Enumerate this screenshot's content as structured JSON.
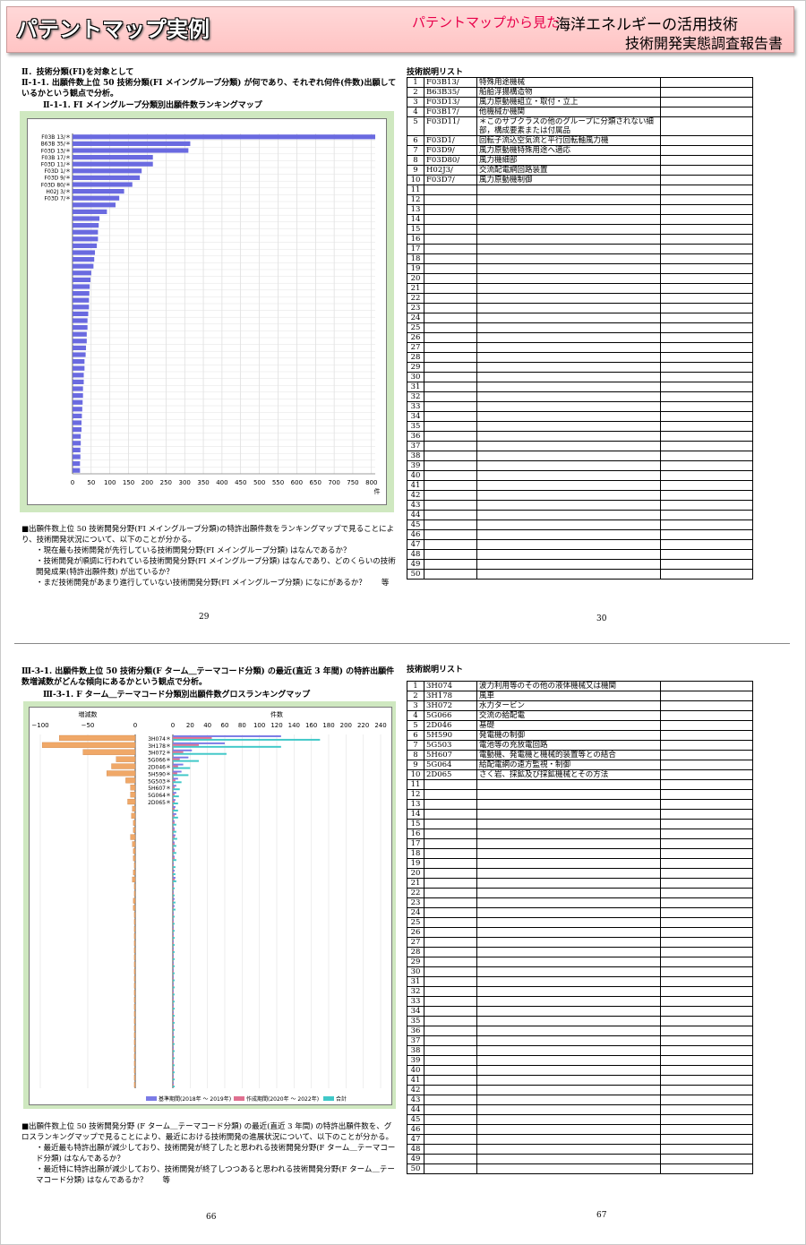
{
  "banner": {
    "title": "パテントマップ実例",
    "subtitle_red": "パテントマップから見た",
    "subtitle_main": "海洋エネルギーの活用技術",
    "subtitle_report": "技術開発実態調査報告書"
  },
  "page29": {
    "section": "Ⅱ．技術分類(FI)を対象として",
    "heading": "Ⅱ-1-1. 出願件数上位 50 技術分類(FI メイングループ分類) が何であり、それぞれ何件(件数)出願しているかという観点で分析。",
    "chart_title": "Ⅱ-1-1. FI メイングループ分類別出願件数ランキングマップ",
    "notes": [
      "■出願件数上位 50 技術開発分野(FI メイングループ分類)の特許出願件数をランキングマップで見ることにより、技術開発状況について、以下のことが分かる。",
      "・現在最も技術開発が先行している技術開発分野(FI メイングループ分類) はなんであるか？",
      "・技術開発が順調に行われている技術開発分野(FI メイングループ分類) はなんであり、どのくらいの技術開発成果(特許出願件数) が出ているか？",
      "・まだ技術開発があまり進行していない技術開発分野(FI メイングループ分類) になにがあるか？　　等"
    ],
    "page_number": "29"
  },
  "page30": {
    "list_title": "技術説明リスト",
    "rows": [
      {
        "no": "1",
        "code": "F03B13/",
        "desc": "特殊用途機械"
      },
      {
        "no": "2",
        "code": "B63B35/",
        "desc": "船舶浮揚構造物"
      },
      {
        "no": "3",
        "code": "F03D13/",
        "desc": "風力原動機組立・取付・立上"
      },
      {
        "no": "4",
        "code": "F03B17/",
        "desc": "他機械か機関"
      },
      {
        "no": "5",
        "code": "F03D11/",
        "desc": "＊このサブクラスの他のグループに分類されない細部，構成要素または付属品"
      },
      {
        "no": "6",
        "code": "F03D1/",
        "desc": "回転子流込空気流と平行回転軸風力機"
      },
      {
        "no": "7",
        "code": "F03D9/",
        "desc": "風力原動機特殊用途へ適応"
      },
      {
        "no": "8",
        "code": "F03D80/",
        "desc": "風力機細部"
      },
      {
        "no": "9",
        "code": "H02J3/",
        "desc": "交流配電網回路装置"
      },
      {
        "no": "10",
        "code": "F03D7/",
        "desc": "風力原動機制御"
      }
    ],
    "row_count": 50,
    "page_number": "30"
  },
  "page66": {
    "heading": "Ⅲ-3-1. 出願件数上位 50 技術分類(F ターム＿テーマコード分類) の最近(直近 3 年間) の特許出願件数増減数がどんな傾向にあるかという観点で分析。",
    "chart_title": "Ⅲ-3-1. F ターム＿テーマコード分類別出願件数グロスランキングマップ",
    "notes": [
      "■出願件数上位 50 技術開発分野 (F ターム＿テーマコード分類) の最近(直近 3 年間) の特許出願件数を、グロスランキングマップで見ることにより、最近における技術開発の進展状況について、以下のことが分かる。",
      "・最近最も特許出願が減少しており、技術開発が終了したと思われる技術開発分野(F ターム＿テーマコード分類) はなんであるか？",
      "・最近特に特許出願が減少しており、技術開発が終了しつつあると思われる技術開発分野(F ターム＿テーマコード分類) はなんであるか？　　等"
    ],
    "page_number": "66"
  },
  "page67": {
    "list_title": "技術説明リスト",
    "rows": [
      {
        "no": "1",
        "code": "3H074",
        "desc": "波力利用等のその他の液体機械又は機関"
      },
      {
        "no": "2",
        "code": "3H178",
        "desc": "風車"
      },
      {
        "no": "3",
        "code": "3H072",
        "desc": "水力タービン"
      },
      {
        "no": "4",
        "code": "5G066",
        "desc": "交流の給配電"
      },
      {
        "no": "5",
        "code": "2D046",
        "desc": "基礎"
      },
      {
        "no": "6",
        "code": "5H590",
        "desc": "発電機の制御"
      },
      {
        "no": "7",
        "code": "5G503",
        "desc": "電池等の充放電回路"
      },
      {
        "no": "8",
        "code": "5H607",
        "desc": "電動機、発電機と機械的装置等との結合"
      },
      {
        "no": "9",
        "code": "5G064",
        "desc": "給配電網の遠方監視・制御"
      },
      {
        "no": "10",
        "code": "2D065",
        "desc": "さく岩、採鉱及び採鉱機械とその方法"
      }
    ],
    "row_count": 50,
    "page_number": "67"
  },
  "chart_data": [
    {
      "type": "bar",
      "orientation": "horizontal",
      "categories": [
        "F03B 13/＊",
        "B63B 35/＊",
        "F03D 13/＊",
        "F03B 17/＊",
        "F03D 11/＊",
        "F03D 1/＊",
        "F03D 9/＊",
        "F03D 80/＊",
        "H02J 3/＊",
        "F03D 7/＊"
      ],
      "values": [
        810,
        315,
        310,
        215,
        215,
        185,
        180,
        160,
        138,
        125,
        115,
        92,
        72,
        70,
        68,
        68,
        65,
        60,
        58,
        56,
        50,
        48,
        46,
        45,
        44,
        44,
        42,
        40,
        40,
        38,
        38,
        36,
        35,
        32,
        32,
        30,
        30,
        28,
        28,
        27,
        26,
        25,
        24,
        24,
        22,
        22,
        21,
        21,
        20,
        20
      ],
      "xticks": [
        "0",
        "50",
        "100",
        "150",
        "200",
        "250",
        "300",
        "350",
        "400",
        "450",
        "500",
        "550",
        "600",
        "650",
        "700",
        "750",
        "800"
      ],
      "xunit": "件",
      "xlim": [
        0,
        810
      ],
      "bar_color": "#6a6ae0"
    },
    {
      "type": "bar",
      "orientation": "horizontal",
      "categories": [
        "3H074＊",
        "3H178＊",
        "3H072＊",
        "5G066＊",
        "2D046＊",
        "5H590＊",
        "5G503＊",
        "5H607＊",
        "5G064＊",
        "2D065＊"
      ],
      "left_axis_label": "増減数",
      "right_axis_label": "件数",
      "left_ticks": [
        "−100",
        "−50",
        "0"
      ],
      "right_ticks": [
        "0",
        "20",
        "40",
        "60",
        "80",
        "100",
        "120",
        "140",
        "160",
        "180",
        "200",
        "220",
        "240"
      ],
      "legend": [
        "基準期間(2018年 〜 2019年)",
        "作成期間(2020年 〜 2022年)",
        "合計"
      ],
      "legend_colors": [
        "#7b7be6",
        "#e07090",
        "#40c8c8"
      ],
      "change": [
        -80,
        -98,
        -55,
        -20,
        -25,
        -30,
        -10,
        -5,
        -5,
        -8,
        -3,
        -4,
        -2,
        -2,
        -5,
        -3,
        -2,
        -2,
        -1,
        -2,
        -3,
        -1,
        -1,
        -2,
        -2,
        -1,
        -1,
        -1,
        -1,
        -1,
        -1,
        -1,
        -1,
        -1,
        -1,
        -1,
        -1,
        -1,
        -1,
        -1,
        -1,
        -1,
        -1,
        -1,
        -1,
        -1,
        -1,
        -1,
        -1,
        -1
      ],
      "base": [
        125,
        60,
        22,
        18,
        12,
        10,
        6,
        4,
        4,
        3,
        3,
        4,
        2,
        2,
        3,
        2,
        2,
        2,
        1,
        2,
        3,
        1,
        1,
        2,
        2,
        1,
        1,
        1,
        1,
        1,
        1,
        1,
        1,
        1,
        1,
        1,
        1,
        1,
        1,
        1,
        1,
        1,
        1,
        1,
        1,
        1,
        1,
        1,
        1,
        1
      ],
      "recent": [
        45,
        30,
        12,
        8,
        6,
        5,
        3,
        2,
        2,
        2,
        2,
        2,
        2,
        2,
        2,
        2,
        2,
        2,
        1,
        1,
        2,
        1,
        1,
        1,
        1,
        1,
        1,
        1,
        1,
        1,
        1,
        1,
        1,
        1,
        1,
        1,
        1,
        1,
        1,
        1,
        1,
        1,
        1,
        1,
        1,
        1,
        1,
        1,
        1,
        1
      ],
      "total": [
        170,
        125,
        62,
        30,
        20,
        18,
        10,
        8,
        7,
        6,
        6,
        6,
        4,
        4,
        5,
        4,
        4,
        4,
        3,
        3,
        4,
        2,
        2,
        3,
        3,
        2,
        2,
        2,
        2,
        2,
        2,
        2,
        2,
        2,
        2,
        2,
        2,
        2,
        2,
        2,
        2,
        2,
        2,
        2,
        2,
        2,
        2,
        2,
        2,
        2
      ]
    }
  ]
}
